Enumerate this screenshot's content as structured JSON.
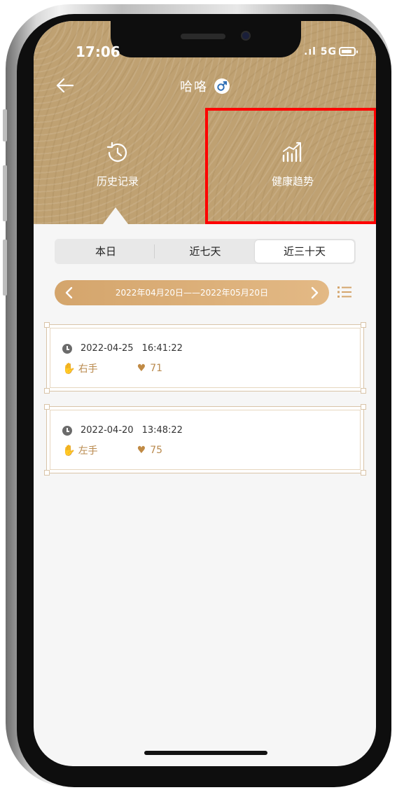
{
  "status": {
    "time": "17:06",
    "network": "5G"
  },
  "header": {
    "name": "哈咯",
    "gender_icon": "male-icon"
  },
  "tabs": [
    {
      "label": "历史记录",
      "icon": "history-icon"
    },
    {
      "label": "健康趋势",
      "icon": "chart-trend-icon"
    }
  ],
  "segment": {
    "items": [
      "本日",
      "近七天",
      "近三十天"
    ],
    "active": "近三十天"
  },
  "range": {
    "text": "2022年04月20日——2022年05月20日"
  },
  "records": [
    {
      "date": "2022-04-25",
      "time": "16:41:22",
      "hand": "右手",
      "heart_rate": "71"
    },
    {
      "date": "2022-04-20",
      "time": "13:48:22",
      "hand": "左手",
      "heart_rate": "75"
    }
  ],
  "colors": {
    "gold": "#bfa172",
    "accent": "#d4a56c",
    "highlight": "#ff0000"
  }
}
